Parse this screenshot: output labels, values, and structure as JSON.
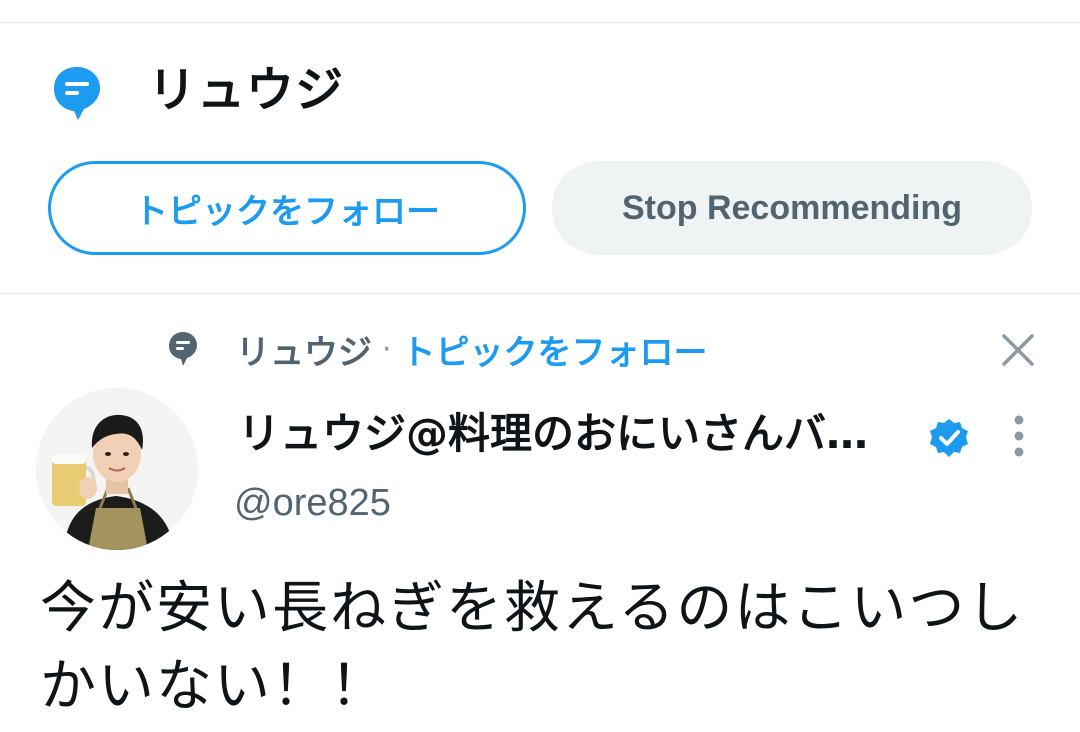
{
  "topic": {
    "title": "リュウジ",
    "follow_label": "トピックをフォロー",
    "stop_label": "Stop Recommending"
  },
  "tweet": {
    "context_topic": "リュウジ",
    "context_separator": "·",
    "context_follow": "トピックをフォロー",
    "display_name": "リュウジ@料理のおにいさんバ…",
    "handle": "@ore825",
    "text": "今が安い長ねぎを救えるのはこいつしかいない！！"
  },
  "colors": {
    "accent": "#1d9bf0",
    "secondary_text": "#536471",
    "primary_text": "#0f1419",
    "stop_bg": "#eff3f4"
  },
  "icons": {
    "topic": "topic-bubble-icon",
    "close": "close-icon",
    "verified": "verified-badge-icon",
    "more": "more-vertical-icon"
  }
}
